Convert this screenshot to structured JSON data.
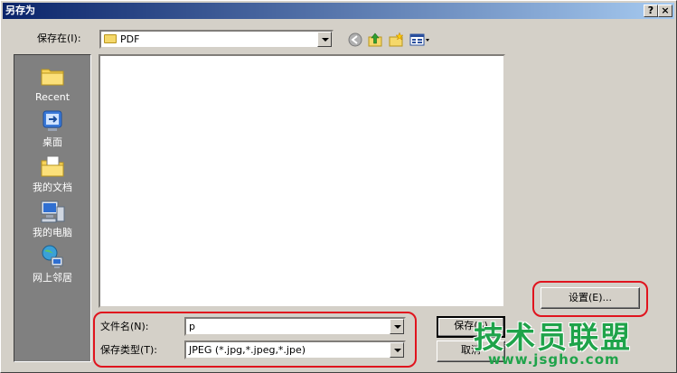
{
  "window": {
    "title": "另存为",
    "help_button": "?",
    "close_button": "×"
  },
  "toolbar": {
    "save_in_label": "保存在(I):",
    "save_in_value": "PDF"
  },
  "places": [
    {
      "label": "Recent",
      "icon": "recent-folder-icon"
    },
    {
      "label": "桌面",
      "icon": "desktop-icon"
    },
    {
      "label": "我的文档",
      "icon": "my-documents-icon"
    },
    {
      "label": "我的电脑",
      "icon": "my-computer-icon"
    },
    {
      "label": "网上邻居",
      "icon": "network-places-icon"
    }
  ],
  "form": {
    "filename_label": "文件名(N):",
    "filename_value": "p",
    "filetype_label": "保存类型(T):",
    "filetype_value": "JPEG (*.jpg,*.jpeg,*.jpe)"
  },
  "buttons": {
    "settings": "设置(E)...",
    "save": "保存(S)",
    "cancel": "取消"
  },
  "watermark": {
    "brand": "技术员联盟",
    "url": "www.jsgho.com"
  },
  "colors": {
    "titlebar_start": "#0a246a",
    "titlebar_end": "#a6caf0",
    "annotation": "#e0141e",
    "watermark": "#1fa34a"
  }
}
